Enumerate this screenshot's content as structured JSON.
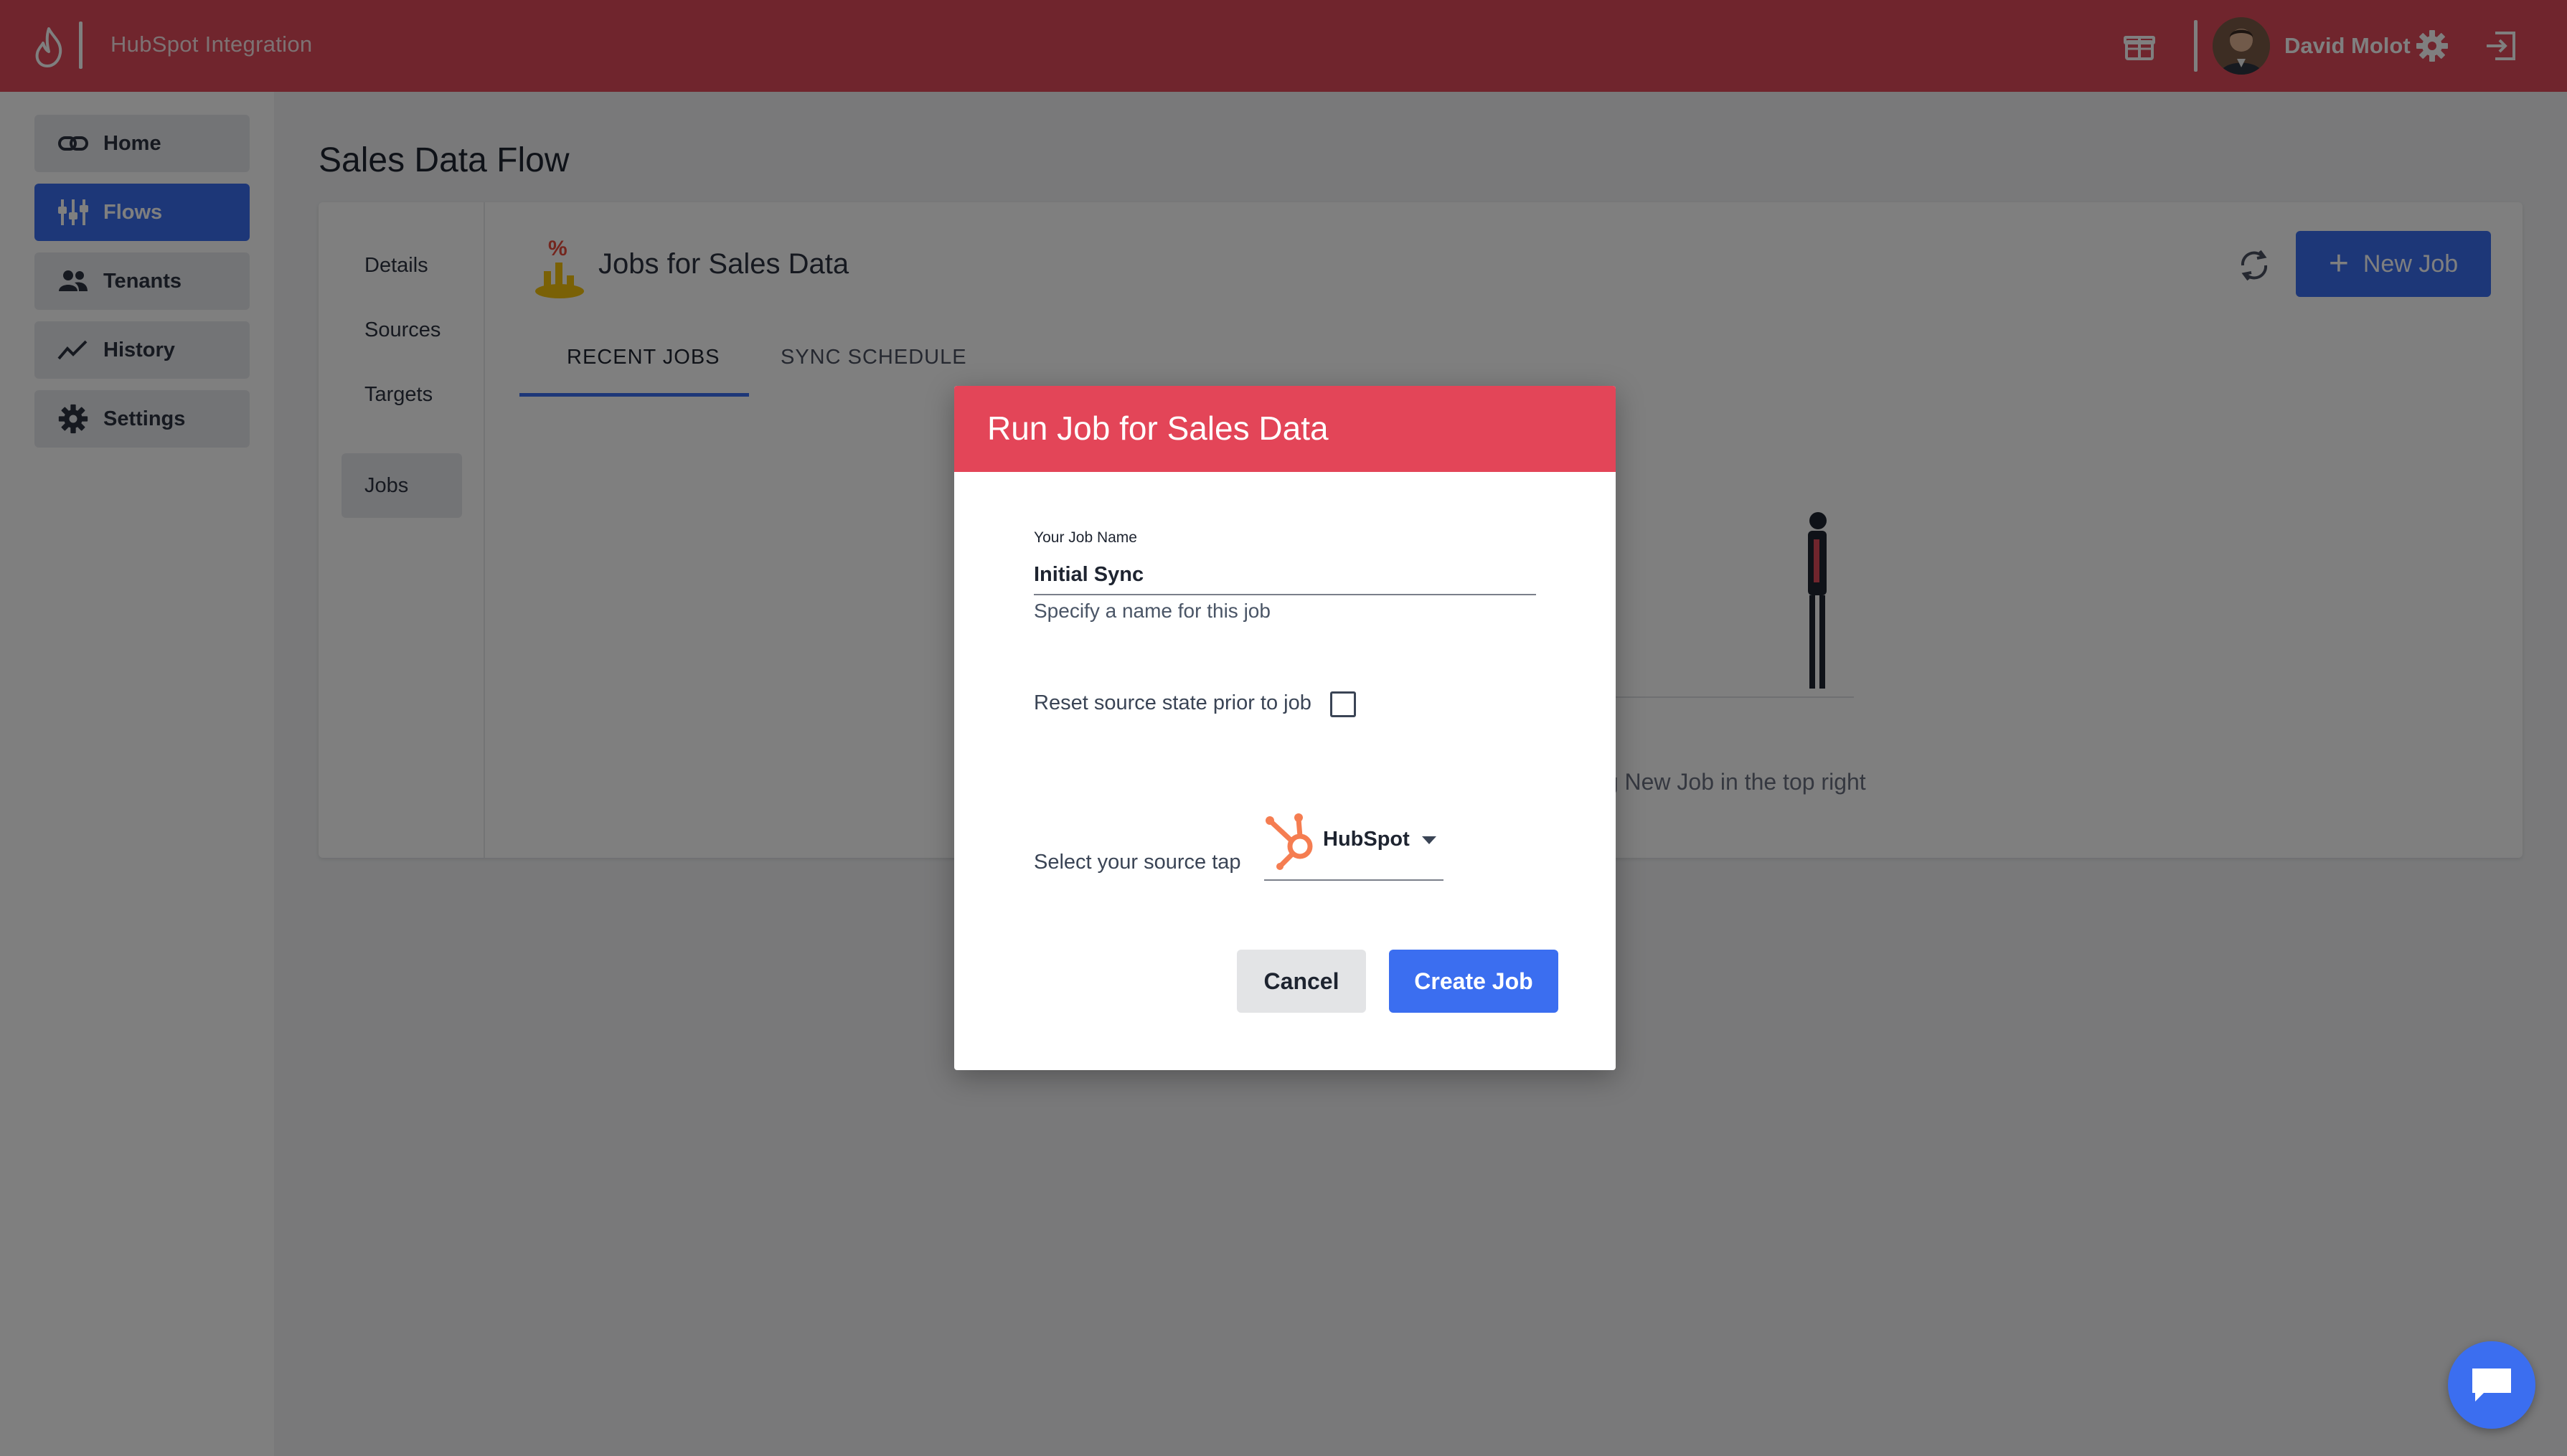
{
  "topbar": {
    "app_title": "HubSpot Integration",
    "user_name": "David Molot",
    "brand_color": "#e14a5a"
  },
  "sidebar": {
    "items": [
      {
        "label": "Home",
        "icon": "link-icon"
      },
      {
        "label": "Flows",
        "icon": "flows-icon",
        "active": true
      },
      {
        "label": "Tenants",
        "icon": "people-icon"
      },
      {
        "label": "History",
        "icon": "trend-icon"
      },
      {
        "label": "Settings",
        "icon": "gear-icon"
      }
    ]
  },
  "main": {
    "page_title": "Sales Data Flow",
    "subnav": [
      "Details",
      "Sources",
      "Targets",
      "Jobs"
    ],
    "active_subnav": "Jobs",
    "card_title": "Jobs for Sales Data",
    "new_job_label": "New Job",
    "tabs": [
      {
        "label": "RECENT JOBS",
        "active": true
      },
      {
        "label": "SYNC SCHEDULE",
        "active": false
      }
    ],
    "hint_text": "ng New Job in the top right"
  },
  "modal": {
    "title": "Run Job for Sales Data",
    "job_name_label": "Your Job Name",
    "job_name_value": "Initial Sync",
    "job_name_help": "Specify a name for this job",
    "reset_label": "Reset source state prior to job",
    "reset_checked": false,
    "source_label": "Select your source tap",
    "source_value": "HubSpot",
    "cancel_label": "Cancel",
    "create_label": "Create Job",
    "header_color": "#e34558",
    "accent_color": "#3b6ef0"
  }
}
